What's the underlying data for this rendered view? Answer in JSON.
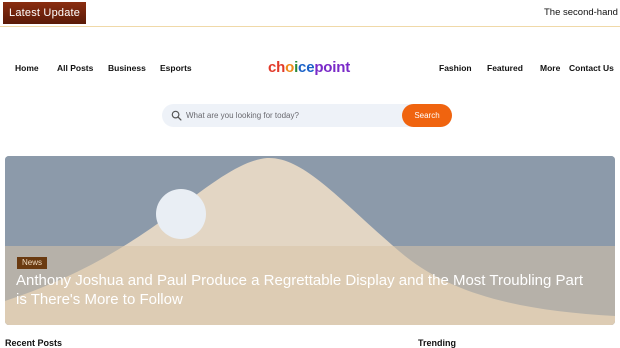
{
  "ticker": {
    "badge": "Latest Update",
    "text": "The second-hand"
  },
  "nav": {
    "left": [
      "Home",
      "All Posts",
      "Business",
      "Esports"
    ],
    "right": [
      "Fashion",
      "Featured",
      "More",
      "Contact Us"
    ],
    "logo": "choicepoint"
  },
  "search": {
    "placeholder": "What are you looking for today?",
    "button": "Search"
  },
  "hero": {
    "category": "News",
    "title": "Anthony Joshua and Paul Produce a Regrettable Display and the Most Troubling Part is There's More to Follow"
  },
  "sections": {
    "recent": "Recent Posts",
    "trending": "Trending"
  },
  "colors": {
    "accent": "#f0640f",
    "badge": "#6a3a10"
  }
}
